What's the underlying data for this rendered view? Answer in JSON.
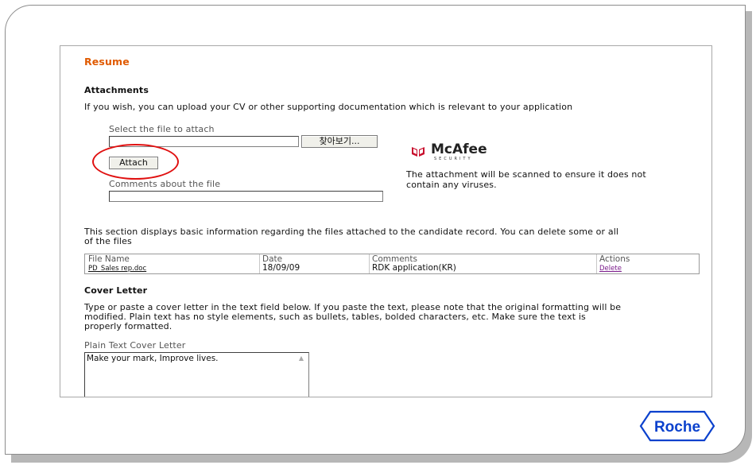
{
  "page": {
    "title": "Resume"
  },
  "attachments": {
    "heading": "Attachments",
    "intro": "If you wish, you can upload your CV or other supporting documentation which is relevant to your application",
    "select_label": "Select the file to attach",
    "file_value": "",
    "browse_label": "찾아보기...",
    "attach_label": "Attach",
    "comments_label": "Comments about the file",
    "comments_value": ""
  },
  "mcafee": {
    "name": "McAfee",
    "sub": "SECURITY",
    "note_line1": "The attachment will be scanned to ensure it does not",
    "note_line2": "contain any viruses."
  },
  "files": {
    "info_line1": "This section displays basic information regarding the files attached to the candidate record. You can delete some or all",
    "info_line2": "of the files",
    "columns": [
      "File Name",
      "Date",
      "Comments",
      "Actions"
    ],
    "rows": [
      {
        "file_name": "PD_Sales rep.doc",
        "date": "18/09/09",
        "comments": "RDK application(KR)",
        "action": "Delete"
      }
    ]
  },
  "cover_letter": {
    "heading": "Cover Letter",
    "para_line1": "Type or paste a cover letter in the text field below. If you paste the text, please note that the original formatting will be",
    "para_line2": "modified. Plain text has no style elements, such as bullets, tables, bolded characters, etc. Make sure the text is",
    "para_line3": "properly formatted.",
    "field_label": "Plain Text Cover Letter",
    "field_value": "Make your mark, Improve lives."
  },
  "brand": {
    "name": "Roche",
    "color": "#0b41cd"
  },
  "colors": {
    "title": "#e05a00",
    "highlight": "#e01010"
  }
}
